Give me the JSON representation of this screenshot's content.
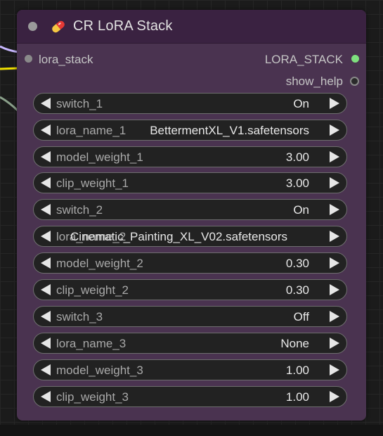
{
  "node": {
    "title": "CR LoRA Stack",
    "title_icon": "pill-icon",
    "inputs": [
      {
        "label": "lora_stack"
      }
    ],
    "outputs": [
      {
        "label": "LORA_STACK",
        "connected_color": "#7ee07e"
      },
      {
        "label": "show_help",
        "connected_color": "#8a8a8a"
      }
    ],
    "widgets": [
      {
        "label": "switch_1",
        "value": "On"
      },
      {
        "label": "lora_name_1",
        "value": "BettermentXL_V1.safetensors"
      },
      {
        "label": "model_weight_1",
        "value": "3.00"
      },
      {
        "label": "clip_weight_1",
        "value": "3.00"
      },
      {
        "label": "switch_2",
        "value": "On"
      },
      {
        "label": "lora_name_2",
        "value": "Cinematic_Painting_XL_V02.safetensors"
      },
      {
        "label": "model_weight_2",
        "value": "0.30"
      },
      {
        "label": "clip_weight_2",
        "value": "0.30"
      },
      {
        "label": "switch_3",
        "value": "Off"
      },
      {
        "label": "lora_name_3",
        "value": "None"
      },
      {
        "label": "model_weight_3",
        "value": "1.00"
      },
      {
        "label": "clip_weight_3",
        "value": "1.00"
      }
    ]
  },
  "colors": {
    "node_body": "#4a3350",
    "node_title": "#3a2241",
    "widget_bg": "#222222",
    "link_lavender": "#c8b8ff",
    "link_yellow": "#f0e000",
    "link_gray": "#8aa08a"
  }
}
